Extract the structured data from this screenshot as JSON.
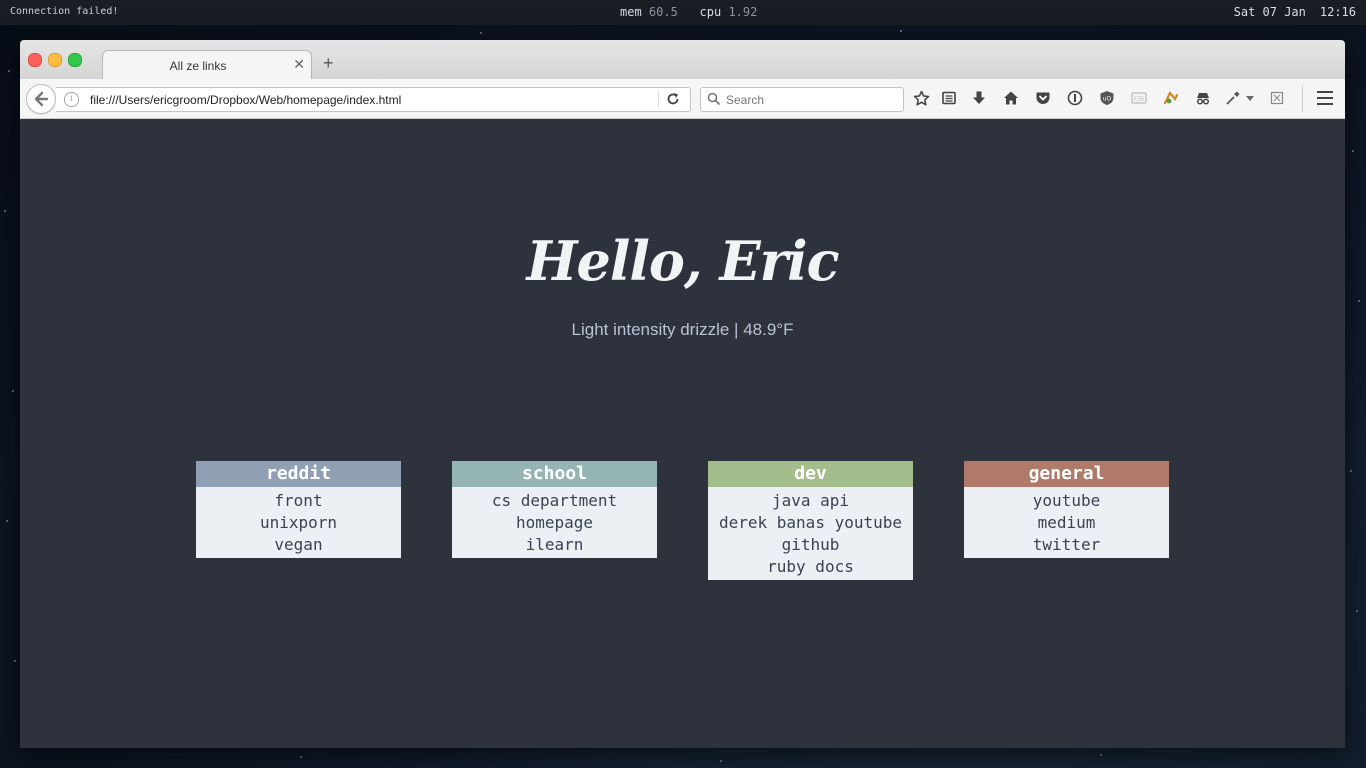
{
  "menubar": {
    "status": "Connection failed!",
    "mem_label": "mem",
    "mem_value": "60.5",
    "cpu_label": "cpu",
    "cpu_value": "1.92",
    "date": "Sat 07 Jan",
    "time": "12:16"
  },
  "browser": {
    "tab_title": "All ze links",
    "url": "file:///Users/ericgroom/Dropbox/Web/homepage/index.html",
    "search_placeholder": "Search"
  },
  "page": {
    "greeting": "Hello, Eric",
    "weather": "Light intensity drizzle | 48.9°F"
  },
  "cards": [
    {
      "title": "reddit",
      "color": "#8f9fb4",
      "links": [
        "front",
        "unixporn",
        "vegan"
      ]
    },
    {
      "title": "school",
      "color": "#95b5b4",
      "links": [
        "cs department",
        "homepage",
        "ilearn"
      ]
    },
    {
      "title": "dev",
      "color": "#a3be8c",
      "links": [
        "java api",
        "derek banas youtube",
        "github",
        "ruby docs"
      ]
    },
    {
      "title": "general",
      "color": "#b07a6a",
      "links": [
        "youtube",
        "medium",
        "twitter"
      ]
    }
  ],
  "icons": [
    "back-arrow-icon",
    "info-icon",
    "reload-icon",
    "search-icon",
    "star-icon",
    "reading-list-icon",
    "download-icon",
    "home-icon",
    "pocket-icon",
    "password-icon",
    "ublock-icon",
    "css-icon",
    "extension-icon",
    "incognito-icon",
    "eyedropper-icon",
    "dropdown-icon",
    "sidebar-icon",
    "menu-icon"
  ]
}
